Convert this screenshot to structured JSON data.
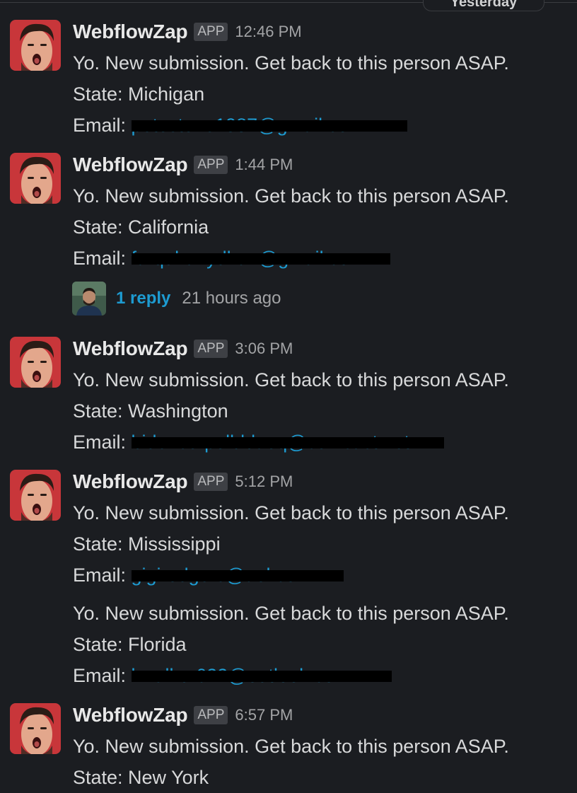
{
  "date_divider": "Yesterday",
  "messages": [
    {
      "sender": "WebflowZap",
      "badge": "APP",
      "time": "12:46 PM",
      "text": "Yo. New submission. Get back to this person ASAP.",
      "state": "State: Michigan",
      "email_label": "Email:",
      "email": "petestone1987@gmail.com"
    },
    {
      "sender": "WebflowZap",
      "badge": "APP",
      "time": "1:44 PM",
      "text": "Yo. New submission. Get back to this person ASAP.",
      "state": "State: California",
      "email_label": "Email:",
      "email": "farquhar.ydhan@gmail.com",
      "reply_count": "1 reply",
      "reply_time": "21 hours ago"
    },
    {
      "sender": "WebflowZap",
      "badge": "APP",
      "time": "3:06 PM",
      "text": "Yo. New submission. Get back to this person ASAP.",
      "state": "State: Washington",
      "email_label": "Email:",
      "email": "bidencorpolbldaoq@comcast.net"
    },
    {
      "sender": "WebflowZap",
      "badge": "APP",
      "time": "5:12 PM",
      "text": "Yo. New submission. Get back to this person ASAP.",
      "state": "State: Mississippi",
      "email_label": "Email:",
      "email": "gigirodgers@aol.com"
    },
    {
      "text": "Yo. New submission. Get back to this person ASAP.",
      "state": "State: Florida",
      "email_label": "Email:",
      "email": "kwalker622@outlook.com"
    },
    {
      "sender": "WebflowZap",
      "badge": "APP",
      "time": "6:57 PM",
      "text": "Yo. New submission. Get back to this person ASAP.",
      "state": "State: New York"
    }
  ]
}
